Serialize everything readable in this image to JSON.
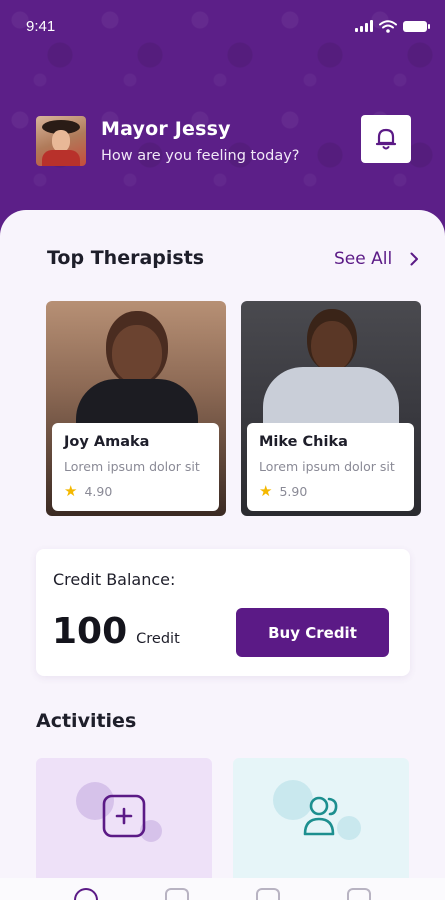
{
  "status_bar": {
    "time": "9:41"
  },
  "user": {
    "name": "Mayor Jessy",
    "greeting": "How are you feeling today?"
  },
  "therapists_section": {
    "title": "Top Therapists",
    "see_all": "See All",
    "items": [
      {
        "name": "Joy Amaka",
        "description": "Lorem ipsum dolor sit",
        "rating": "4.90"
      },
      {
        "name": "Mike Chika",
        "description": "Lorem ipsum dolor sit",
        "rating": "5.90"
      }
    ]
  },
  "credit": {
    "label": "Credit Balance:",
    "amount": "100",
    "unit": "Credit",
    "buy_label": "Buy Credit"
  },
  "activities": {
    "title": "Activities",
    "items": [
      {
        "icon": "add-square-icon"
      },
      {
        "icon": "users-icon"
      }
    ]
  },
  "colors": {
    "brand": "#5b1a86",
    "accent_star": "#f4b800"
  }
}
